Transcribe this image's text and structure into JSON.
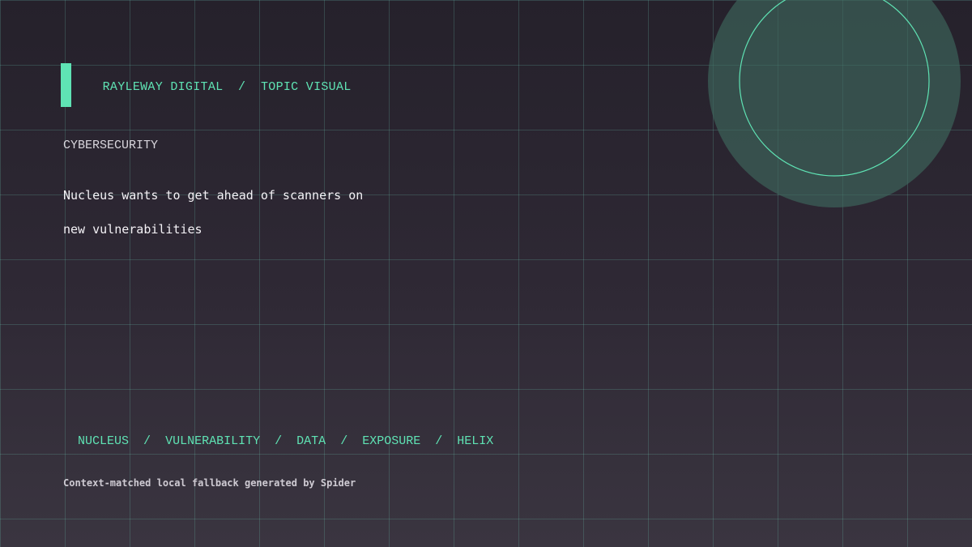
{
  "header": {
    "brand": "RAYLEWAY DIGITAL",
    "separator": "/",
    "section": "TOPIC VISUAL"
  },
  "article": {
    "category": "CYBERSECURITY",
    "headline_lines": [
      "Nucleus wants to get ahead of scanners on",
      "new vulnerabilities"
    ]
  },
  "tags": {
    "separator": "/",
    "items": [
      "NUCLEUS",
      "VULNERABILITY",
      "DATA",
      "EXPOSURE",
      "HELIX"
    ]
  },
  "footer": {
    "note": "Context-matched local fallback generated by Spider"
  },
  "colors": {
    "accent": "#5fe3b4",
    "headline": "#f4f2f6",
    "category": "#d9d6dd",
    "footer": "#cfcbd3",
    "circle_fill": "#3f6b5f"
  }
}
